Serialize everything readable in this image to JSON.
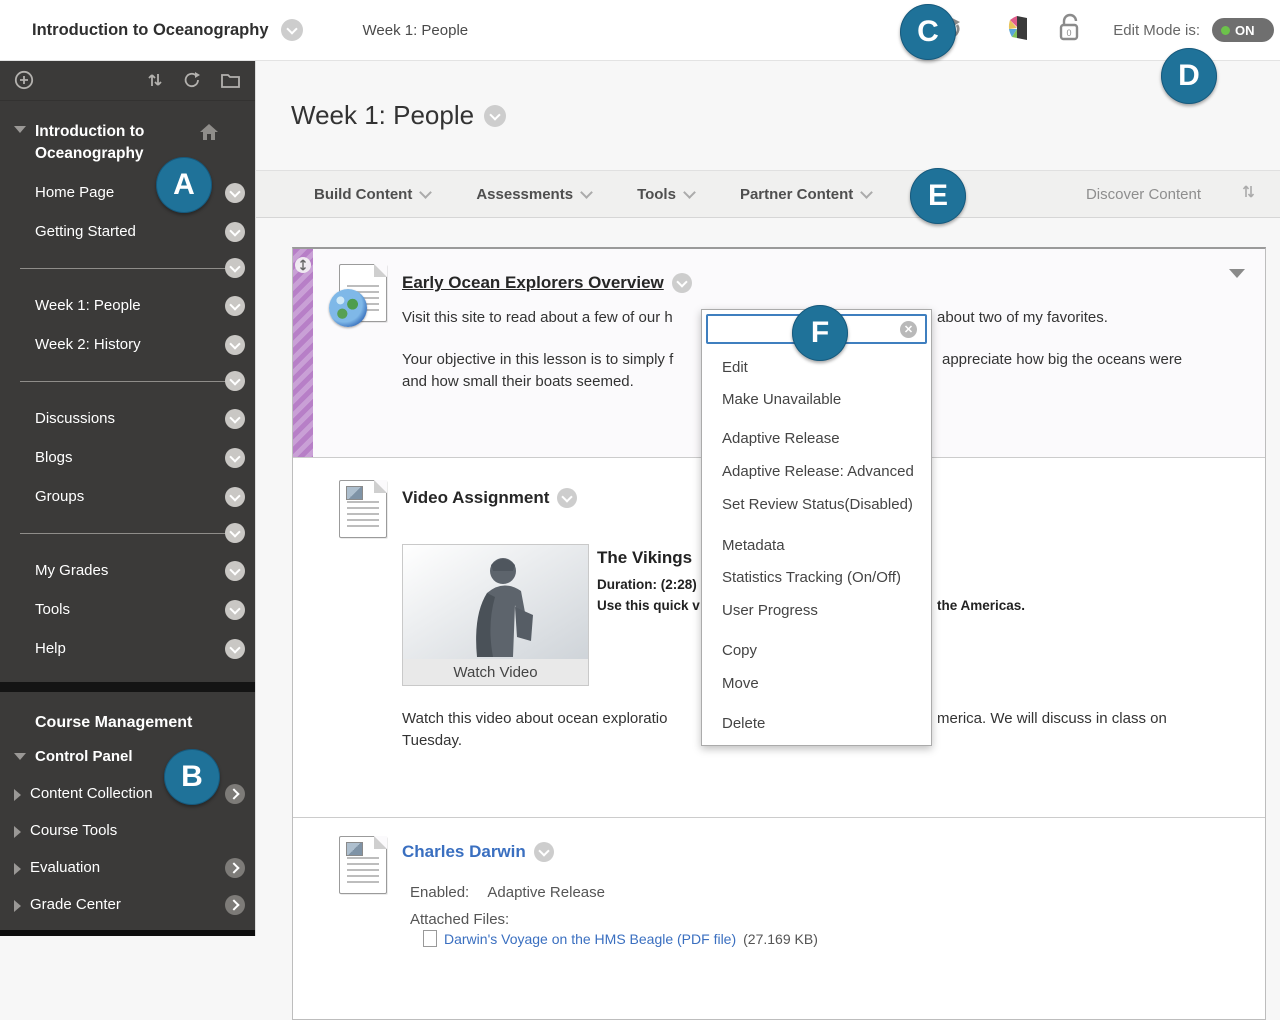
{
  "header": {
    "course_title": "Introduction to Oceanography",
    "breadcrumb": "Week 1: People",
    "edit_mode_label": "Edit Mode is:",
    "edit_mode_state": "ON"
  },
  "annotations": {
    "a": "A",
    "b": "B",
    "c": "C",
    "d": "D",
    "e": "E",
    "f": "F"
  },
  "sidebar": {
    "course_menu_title": "Introduction to Oceanography",
    "items": [
      "Home Page",
      "Getting Started",
      "Week 1: People",
      "Week 2: History",
      "Discussions",
      "Blogs",
      "Groups",
      "My Grades",
      "Tools",
      "Help"
    ],
    "management_title": "Course Management",
    "control_panel_label": "Control Panel",
    "management_items": [
      "Content Collection",
      "Course Tools",
      "Evaluation",
      "Grade Center"
    ]
  },
  "page": {
    "title": "Week 1: People"
  },
  "action_bar": {
    "menus": [
      "Build Content",
      "Assessments",
      "Tools",
      "Partner Content"
    ],
    "discover": "Discover Content"
  },
  "content": {
    "item1": {
      "title": "Early Ocean Explorers Overview",
      "p1_left": "Visit this site to read about a few of our h",
      "p1_right": "about two of my favorites.",
      "p2_left": "Your objective in this lesson is to simply f",
      "p2_right": "appreciate how big the oceans were",
      "p2_line2": "and how small their boats seemed."
    },
    "item2": {
      "title": "Video Assignment",
      "video_title": "The Vikings",
      "duration": "Duration: (2:28)",
      "use_left": "Use this quick v",
      "use_right": "the Americas.",
      "watch_label": "Watch Video",
      "desc_left": "Watch this video about ocean exploratio",
      "desc_right": "merica. We will discuss in class on",
      "desc_line2": "Tuesday."
    },
    "item3": {
      "title": "Charles Darwin",
      "enabled_label": "Enabled:",
      "enabled_value": "Adaptive Release",
      "attached_label": "Attached Files:",
      "attachment_link": "Darwin's Voyage on the HMS Beagle (PDF file)",
      "attachment_size": "(27.169 KB)"
    }
  },
  "context_menu": {
    "search_placeholder": "",
    "items": [
      "Edit",
      "Make Unavailable",
      "Adaptive Release",
      "Adaptive Release: Advanced",
      "Set Review Status(Disabled)",
      "Metadata",
      "Statistics Tracking (On/Off)",
      "User Progress",
      "Copy",
      "Move",
      "Delete"
    ]
  },
  "icons": {
    "header": [
      "student-preview-icon",
      "theme-palette-icon",
      "unlock-icon"
    ],
    "sidebar_toolbar": [
      "add-menu-item-icon",
      "reorder-icon",
      "refresh-icon",
      "folder-view-icon"
    ],
    "colors": {
      "annotation_blue": "#1f7299",
      "stripe_purple": "#b77fc7",
      "link_blue": "#3a6fc0",
      "edit_on_green": "#6cc24a",
      "menu_focus_blue": "#3f7fbf"
    }
  }
}
